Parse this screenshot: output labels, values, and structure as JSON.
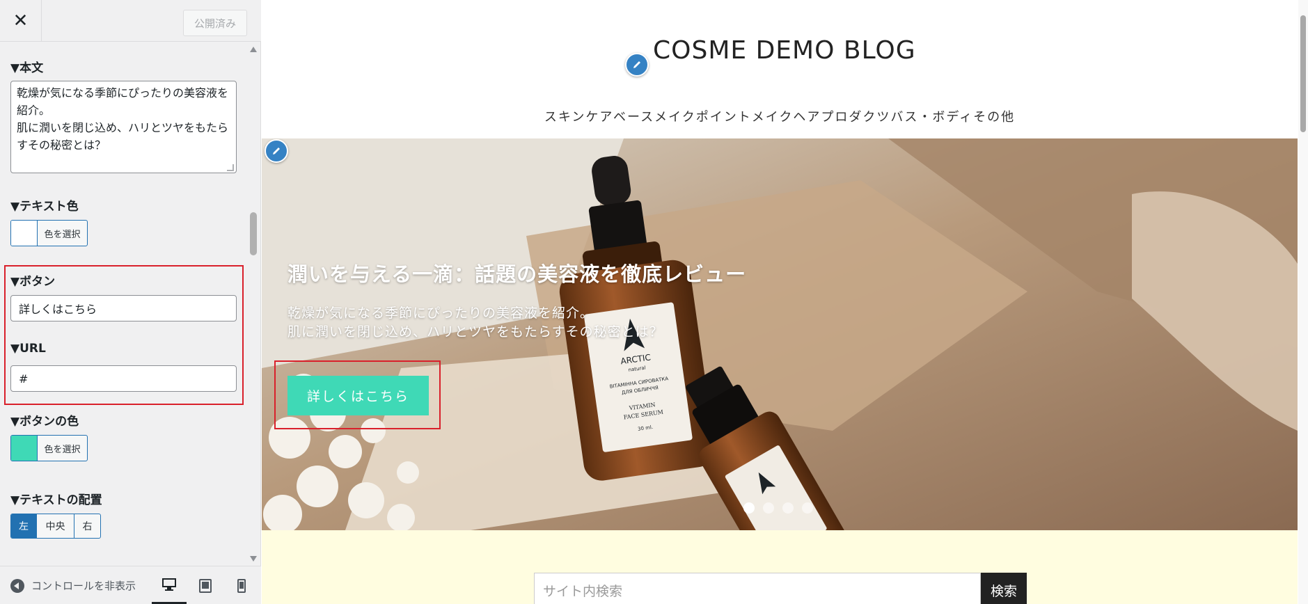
{
  "sidebar": {
    "close_label": "✕",
    "publish_label": "公開済み",
    "body_section": {
      "title": "▼本文",
      "value": "乾燥が気になる季節にぴったりの美容液を紹介。\n肌に潤いを閉じ込め、ハリとツヤをもたらすその秘密とは？"
    },
    "text_color_section": {
      "title": "▼テキスト色",
      "picker_label": "色を選択",
      "color": "#ffffff"
    },
    "button_section": {
      "title": "▼ボタン",
      "value": "詳しくはこちら"
    },
    "url_section": {
      "title": "▼URL",
      "value": "#"
    },
    "button_color_section": {
      "title": "▼ボタンの色",
      "picker_label": "色を選択",
      "color": "#3fd9b6"
    },
    "text_align_section": {
      "title": "▼テキストの配置",
      "options": [
        {
          "label": "左",
          "active": true
        },
        {
          "label": "中央",
          "active": false
        },
        {
          "label": "右",
          "active": false
        }
      ]
    },
    "footer": {
      "collapse_label": "コントロールを非表示",
      "devices": [
        "desktop-icon",
        "tablet-icon",
        "mobile-icon"
      ],
      "active_device": "desktop"
    }
  },
  "preview": {
    "site_title": "COSME DEMO BLOG",
    "nav": "スキンケアベースメイクポイントメイクヘアプロダクツバス・ボディその他",
    "hero": {
      "title": "潤いを与える一滴：話題の美容液を徹底レビュー",
      "text_line1": "乾燥が気になる季節にぴったりの美容液を紹介。",
      "text_line2": "肌に潤いを閉じ込め、ハリとツヤをもたらすその秘密とは？",
      "button_label": "詳しくはこちら",
      "slides": 4,
      "active_slide": 1,
      "bottle_labels": {
        "brand": "ARCTIC",
        "sub": "natural",
        "ua1": "ВІТАМІННА СИРОВАТКА",
        "ua2": "ДЛЯ ОБЛИЧЧЯ",
        "en1": "VITAMIN",
        "en2": "FACE SERUM",
        "volume": "30 ml."
      }
    },
    "search": {
      "placeholder": "サイト内検索",
      "button_label": "検索"
    }
  },
  "colors": {
    "accent": "#2271b1",
    "highlight": "#d9202b",
    "button": "#3fd9b6",
    "edit_shortcut": "#3582c4"
  }
}
